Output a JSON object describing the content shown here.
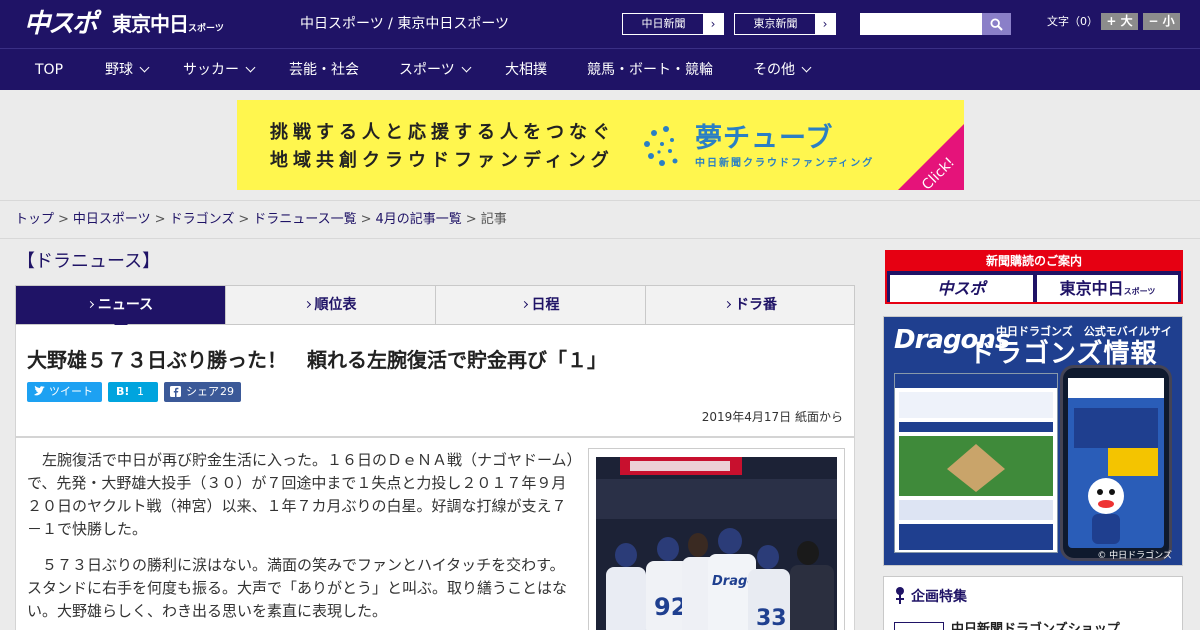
{
  "header": {
    "logo_chunichi": "中スポ",
    "logo_tokyo": "東京中日",
    "logo_tokyo_small": "スポーツ",
    "sites_title": "中日スポーツ / 東京中日スポーツ",
    "ext_links": [
      {
        "label": "中日新聞",
        "arrow": "›"
      },
      {
        "label": "東京新聞",
        "arrow": "›"
      }
    ],
    "search_placeholder": "",
    "fontsize_label": "文字（0）",
    "fontsize_big": "+ 大",
    "fontsize_small": "− 小"
  },
  "nav": {
    "items": [
      {
        "label": "TOP"
      },
      {
        "label": "野球"
      },
      {
        "label": "サッカー"
      },
      {
        "label": "芸能・社会"
      },
      {
        "label": "スポーツ"
      },
      {
        "label": "大相撲"
      },
      {
        "label": "競馬・ボート・競輪"
      },
      {
        "label": "その他"
      }
    ]
  },
  "banner": {
    "line1": "挑戦する人と応援する人をつなぐ",
    "line2": "地域共創クラウドファンディング",
    "brand": "夢チューブ",
    "brand_sub": "中日新聞クラウドファンディング",
    "click": "Click!",
    "colors": {
      "background": "#fff64e",
      "brand": "#2a7fc4",
      "corner": "#e5137a"
    }
  },
  "breadcrumb": {
    "items": [
      "トップ",
      "中日スポーツ",
      "ドラゴンズ",
      "ドラニュース一覧",
      "4月の記事一覧"
    ],
    "current": "記事",
    "separator": ">"
  },
  "main": {
    "section_title": "【ドラニュース】",
    "tabs": [
      {
        "label": "ニュース",
        "active": true
      },
      {
        "label": "順位表",
        "active": false
      },
      {
        "label": "日程",
        "active": false
      },
      {
        "label": "ドラ番",
        "active": false
      }
    ],
    "article": {
      "headline": "大野雄５７３日ぶり勝った！　頼れる左腕復活で貯金再び「１」",
      "share": {
        "tweet_label": "ツイート",
        "hatena_label": "B!",
        "hatena_count": "1",
        "facebook_label": "シェア",
        "facebook_count": "29"
      },
      "dateline": "2019年4月17日 紙面から",
      "paragraphs": [
        "左腕復活で中日が再び貯金生活に入った。１６日のＤｅＮＡ戦（ナゴヤドーム）で、先発・大野雄大投手（３０）が７回途中まで１失点と力投し２０１７年９月２０日のヤクルト戦（神宮）以来、１年７カ月ぶりの白星。好調な打線が支え７－１で快勝した。",
        "５７３日ぶりの勝利に涙はない。満面の笑みでファンとハイタッチを交わす。スタンドに右手を何度も振る。大声で「ありがとう」と叫ぶ。取り繕うことはない。大野雄らしく、わき出る思いを素直に表現した。"
      ]
    }
  },
  "sidebar": {
    "subscribe": {
      "head": "新聞購読のご案内",
      "btn1": "中スポ",
      "btn2": "東京中日",
      "btn2_small": "スポーツ"
    },
    "dragons_ad": {
      "logo": "Dragons",
      "tag": "中日ドラゴンズ　公式モバイルサイト",
      "title": "ドラゴンズ情報",
      "copyright": "© 中日ドラゴンズ"
    },
    "feature": {
      "title": "企画特集",
      "item_label": "中日新聞ドラゴンズショップ"
    }
  },
  "colors": {
    "brand_navy": "#1f1366",
    "accent_red": "#e60012",
    "twitter": "#1da1f2",
    "hatena": "#00a4de",
    "facebook": "#3b5998"
  }
}
